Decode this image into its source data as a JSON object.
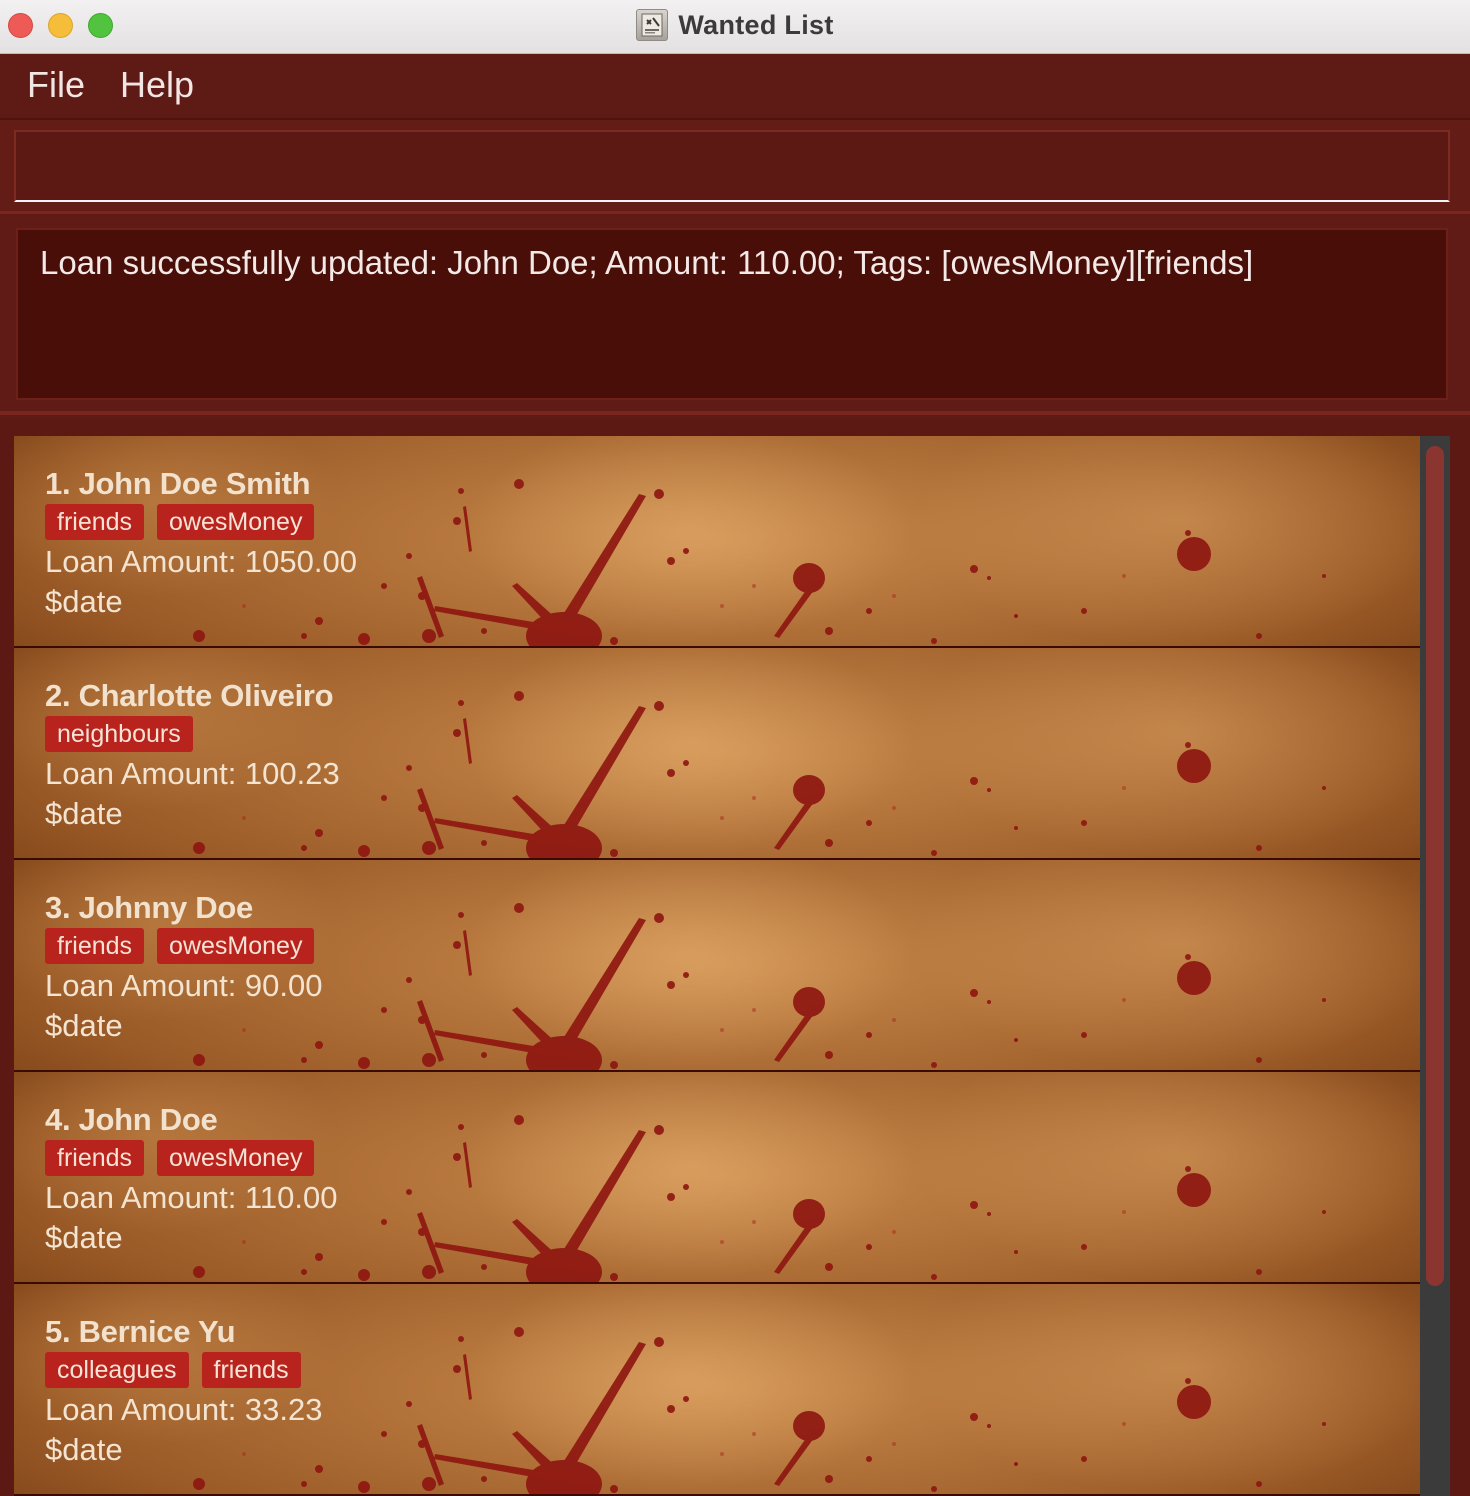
{
  "window": {
    "title": "Wanted List",
    "app_icon": "wanted-poster-icon"
  },
  "menu": {
    "items": [
      "File",
      "Help"
    ]
  },
  "command_box": {
    "value": "",
    "placeholder": ""
  },
  "result": {
    "message": "Loan successfully updated: John Doe; Amount: 110.00; Tags: [owesMoney][friends]"
  },
  "colors": {
    "background": "#5e1a15",
    "result_box": "#4a0e09",
    "tag": "#b8231d",
    "card_parchment": "#c98a4c",
    "scroll_thumb": "#8a3530"
  },
  "people": [
    {
      "name": "1. John Doe Smith",
      "tags": [
        "friends",
        "owesMoney"
      ],
      "amount": "Loan Amount: 1050.00",
      "date": "$date"
    },
    {
      "name": "2. Charlotte Oliveiro",
      "tags": [
        "neighbours"
      ],
      "amount": "Loan Amount: 100.23",
      "date": "$date"
    },
    {
      "name": "3. Johnny Doe",
      "tags": [
        "friends",
        "owesMoney"
      ],
      "amount": "Loan Amount: 90.00",
      "date": "$date"
    },
    {
      "name": "4. John Doe",
      "tags": [
        "friends",
        "owesMoney"
      ],
      "amount": "Loan Amount: 110.00",
      "date": "$date"
    },
    {
      "name": "5. Bernice Yu",
      "tags": [
        "colleagues",
        "friends"
      ],
      "amount": "Loan Amount: 33.23",
      "date": "$date"
    }
  ]
}
